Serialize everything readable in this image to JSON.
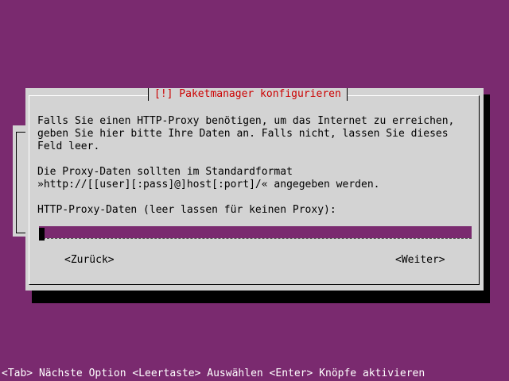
{
  "dialog": {
    "title": "[!] Paketmanager konfigurieren",
    "lines": [
      "Falls Sie einen HTTP-Proxy benötigen, um das Internet zu erreichen,",
      "geben Sie hier bitte Ihre Daten an. Falls nicht, lassen Sie dieses",
      "Feld leer.",
      "Die Proxy-Daten sollten im Standardformat",
      "»http://[[user][:pass]@]host[:port]/« angegeben werden.",
      "HTTP-Proxy-Daten (leer lassen für keinen Proxy):"
    ],
    "proxy_input": {
      "value": ""
    },
    "buttons": {
      "back": "<Zurück>",
      "next": "<Weiter>"
    }
  },
  "statusbar": {
    "text": "<Tab> Nächste Option <Leertaste> Auswählen <Enter> Knöpfe aktivieren"
  },
  "colors": {
    "background": "#7a2a6f",
    "dialog": "#d3d3d3",
    "title": "#cc0000",
    "input_bg": "#7a2a6f"
  }
}
